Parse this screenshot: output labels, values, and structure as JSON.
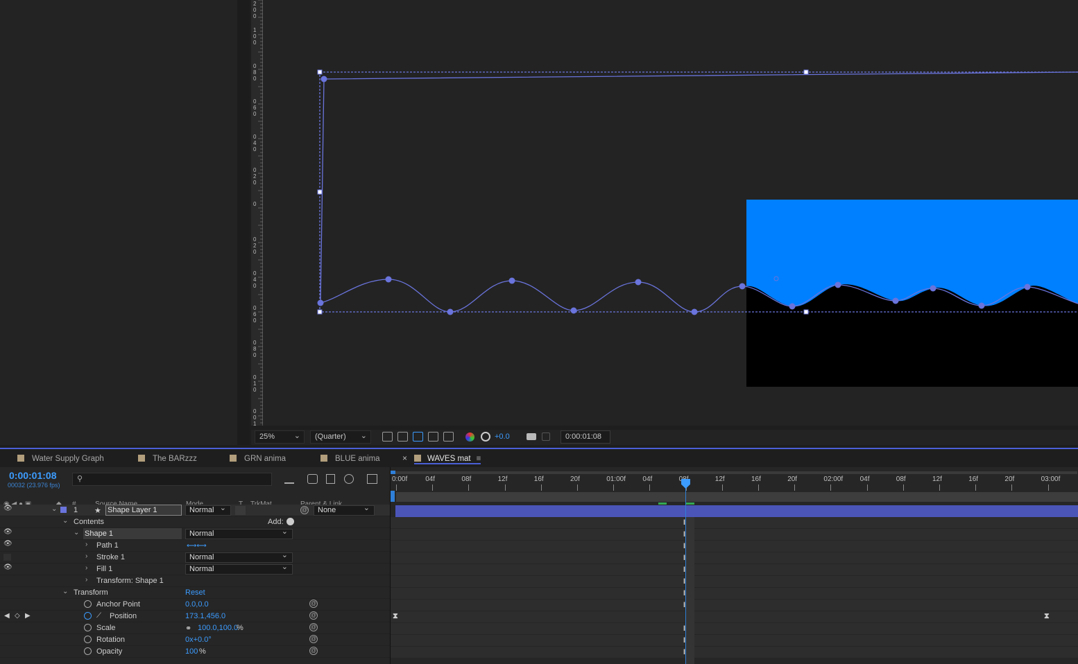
{
  "app": {
    "name": "After Effects"
  },
  "composition_panel": {
    "ruler_labels": [
      "2",
      "0",
      "0",
      "1",
      "0",
      "0",
      "0",
      "8",
      "0",
      "0",
      "6",
      "0",
      "0",
      "4",
      "0",
      "0",
      "2",
      "0",
      "0",
      "0",
      "2",
      "0",
      "0",
      "4",
      "0",
      "0",
      "6",
      "0",
      "0",
      "8",
      "0",
      "0",
      "1",
      "0",
      "0",
      "0",
      "1",
      "2"
    ],
    "layer_colors": {
      "accent": "#6a74dc",
      "water": "#0080ff",
      "matte": "#000000"
    }
  },
  "viewer_toolbar": {
    "zoom": "25%",
    "resolution": "(Quarter)",
    "exposure": "+0.0",
    "timecode": "0:00:01:08"
  },
  "tabs": [
    {
      "label": "Water Supply Graph"
    },
    {
      "label": "The BARzzz"
    },
    {
      "label": "GRN anima"
    },
    {
      "label": "BLUE anima"
    },
    {
      "label": "WAVES mat",
      "active": true
    }
  ],
  "timeline": {
    "current_time": "0:00:01:08",
    "frame_info": "00032 (23.976 fps)",
    "columns": {
      "num": "#",
      "source": "Source Name",
      "mode": "Mode",
      "t": "T",
      "trkmat": "TrkMat",
      "parent": "Parent & Link"
    },
    "layer": {
      "index": "1",
      "name": "Shape Layer 1",
      "mode": "Normal",
      "parent": "None"
    },
    "contents_label": "Contents",
    "add_label": "Add:",
    "shape": {
      "name": "Shape 1",
      "mode": "Normal"
    },
    "path": {
      "name": "Path 1"
    },
    "stroke": {
      "name": "Stroke 1",
      "mode": "Normal"
    },
    "fill": {
      "name": "Fill 1",
      "mode": "Normal"
    },
    "transform_shape": {
      "name": "Transform: Shape 1"
    },
    "transform": {
      "name": "Transform",
      "reset": "Reset"
    },
    "properties": [
      {
        "name": "Anchor Point",
        "value": "0.0,0.0",
        "unit": ""
      },
      {
        "name": "Position",
        "value": "173.1,456.0",
        "unit": ""
      },
      {
        "name": "Scale",
        "value": "100.0,100.0",
        "unit": "%"
      },
      {
        "name": "Rotation",
        "value": "0x+0.0°",
        "unit": ""
      },
      {
        "name": "Opacity",
        "value": "100",
        "unit": "%"
      }
    ],
    "ruler_ticks": [
      "0:00f",
      "04f",
      "08f",
      "12f",
      "16f",
      "20f",
      "01:00f",
      "04f",
      "08f",
      "12f",
      "16f",
      "20f",
      "02:00f",
      "04f",
      "08f",
      "12f",
      "16f",
      "20f",
      "03:00f"
    ]
  }
}
